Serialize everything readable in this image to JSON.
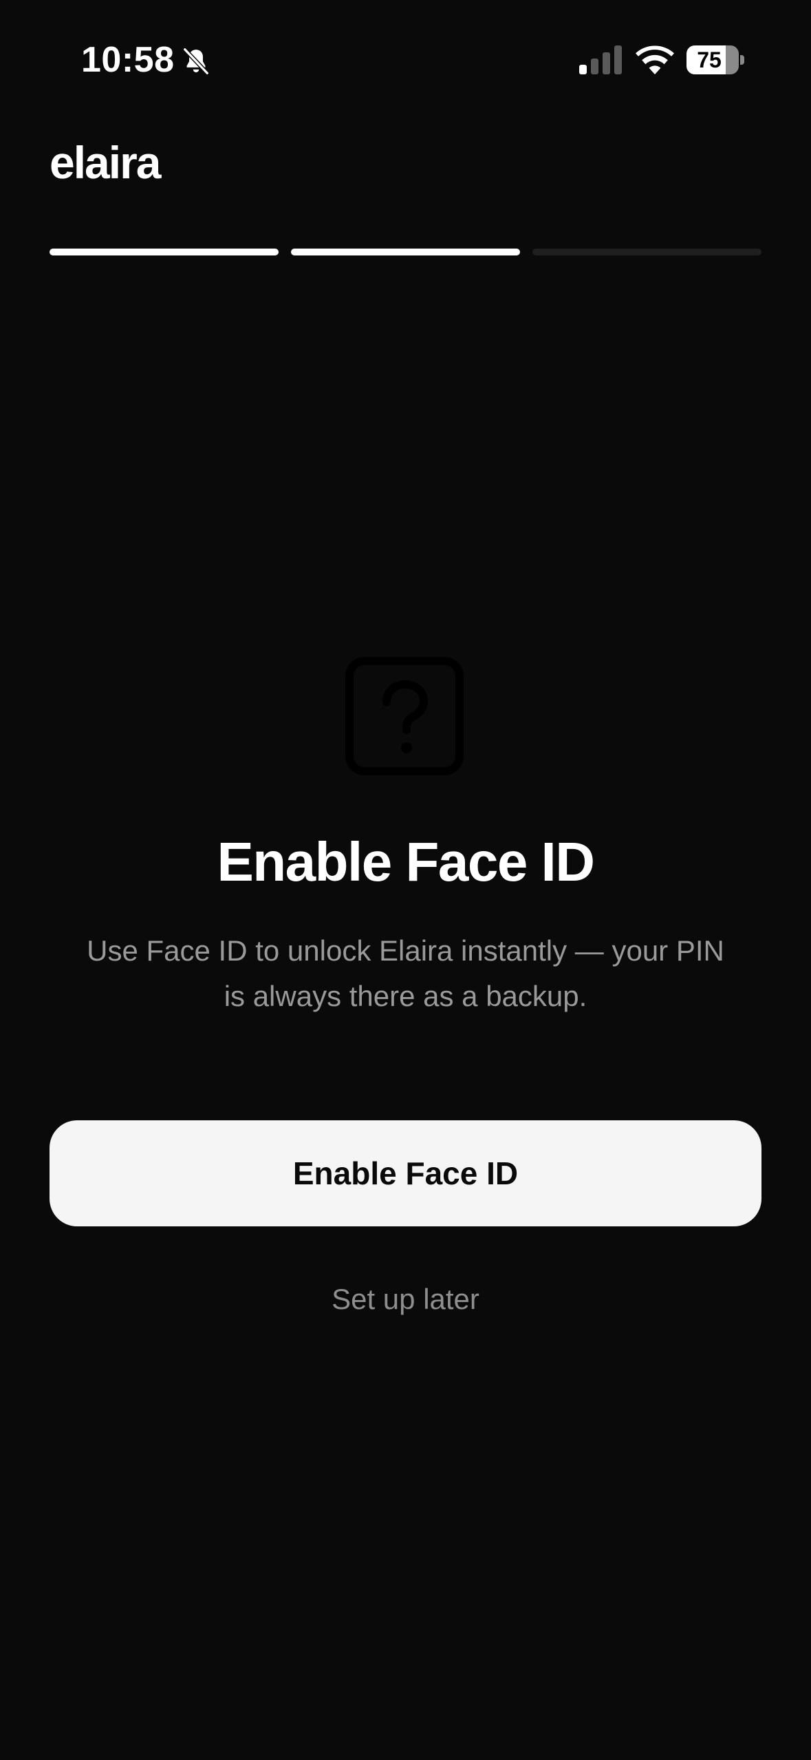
{
  "status_bar": {
    "time": "10:58",
    "battery_level": "75",
    "icons": [
      "bell-slash-icon",
      "cellular-signal-icon",
      "wifi-icon",
      "battery-icon"
    ]
  },
  "header": {
    "brand": "elaira"
  },
  "progress": {
    "total_steps": 3,
    "completed_steps": 2
  },
  "main": {
    "icon": "question-mark-square-icon",
    "title": "Enable Face ID",
    "subtitle_line1": "Use Face ID to unlock Elaira instantly — your PIN",
    "subtitle_line2": "is always there as a backup.",
    "primary_button_label": "Enable Face ID",
    "secondary_button_label": "Set up later"
  },
  "colors": {
    "background": "#0a0a0a",
    "text_primary": "#ffffff",
    "text_secondary": "#9a9a9a",
    "button_bg": "#f5f5f5",
    "button_text": "#0a0a0a",
    "progress_inactive": "#1f1f1f"
  }
}
